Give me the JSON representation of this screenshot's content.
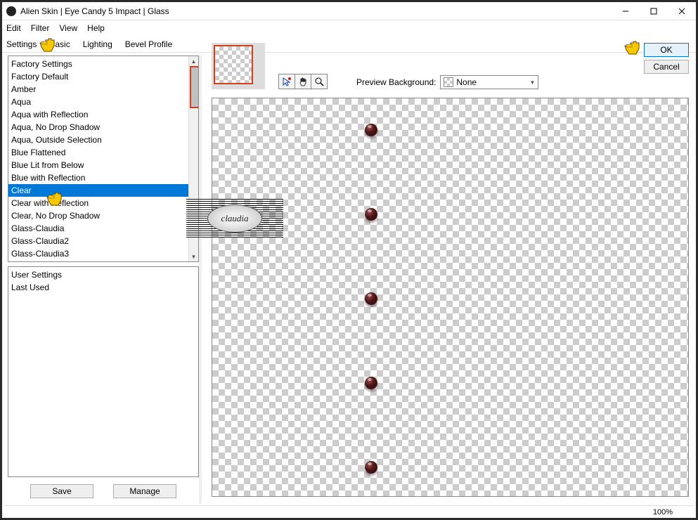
{
  "window": {
    "title": "Alien Skin | Eye Candy 5 Impact | Glass"
  },
  "menu": {
    "edit": "Edit",
    "filter": "Filter",
    "view": "View",
    "help": "Help"
  },
  "tabs": {
    "settings": "Settings",
    "basic": "Basic",
    "lighting": "Lighting",
    "bevel": "Bevel Profile"
  },
  "factory_list": {
    "items": [
      "Factory Settings",
      "Factory Default",
      "Amber",
      "Aqua",
      "Aqua with Reflection",
      "Aqua, No Drop Shadow",
      "Aqua, Outside Selection",
      "Blue Flattened",
      "Blue Lit from Below",
      "Blue with Reflection",
      "Clear",
      "Clear with Reflection",
      "Clear, No Drop Shadow",
      "Glass-Claudia",
      "Glass-Claudia2",
      "Glass-Claudia3"
    ],
    "selected_index": 10
  },
  "user_list": {
    "items": [
      "User Settings",
      "Last Used"
    ]
  },
  "buttons": {
    "save": "Save",
    "manage": "Manage",
    "ok": "OK",
    "cancel": "Cancel"
  },
  "preview": {
    "label": "Preview Background:",
    "combo_value": "None"
  },
  "status": {
    "zoom": "100%"
  },
  "badge": {
    "text": "claudia"
  }
}
